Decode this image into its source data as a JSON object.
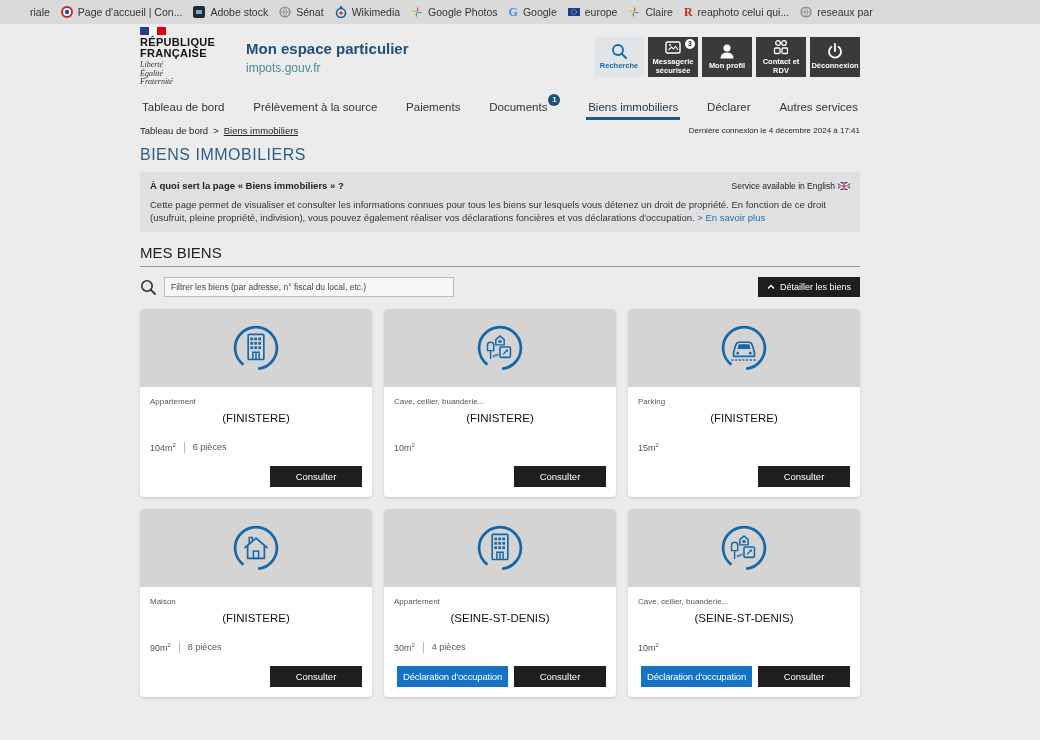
{
  "bookmarks": [
    {
      "label": "riale"
    },
    {
      "kind": "ring",
      "label": "Page d'accueil | Con..."
    },
    {
      "kind": "tile",
      "label": "Adobe stock"
    },
    {
      "kind": "globe",
      "label": "Sénat"
    },
    {
      "kind": "drop",
      "label": "Wikimedia"
    },
    {
      "kind": "pinwheel",
      "label": "Google Photos"
    },
    {
      "kind": "letter",
      "glyph": "G",
      "color": "#4285f4",
      "label": "Google"
    },
    {
      "kind": "flag",
      "label": "europe"
    },
    {
      "kind": "pinwheel",
      "label": "Claire"
    },
    {
      "kind": "letter",
      "glyph": "R",
      "color": "#c62828",
      "label": "reaphoto celui qui..."
    },
    {
      "kind": "globe",
      "label": "reseaux par"
    }
  ],
  "header": {
    "logo": {
      "name": [
        "RÉPUBLIQUE",
        "FRANÇAISE"
      ],
      "motto": [
        "Liberté",
        "Égalité",
        "Fraternité"
      ]
    },
    "title": "Mon espace particulier",
    "site": "impots.gouv.fr",
    "tools": [
      {
        "kind": "search",
        "label": "Recherche"
      },
      {
        "kind": "mail",
        "label": "Messagerie sécurisée",
        "badge": "3"
      },
      {
        "kind": "profile",
        "label": "Mon profil"
      },
      {
        "kind": "contact",
        "label": "Contact et RDV"
      },
      {
        "kind": "logout",
        "label": "Déconnexion"
      }
    ]
  },
  "nav": {
    "tabs": [
      {
        "label": "Tableau de bord",
        "selected": false
      },
      {
        "label": "Prélèvement à la source",
        "selected": false
      },
      {
        "label": "Paiements",
        "selected": false
      },
      {
        "label": "Documents",
        "selected": false,
        "badge": "1"
      },
      {
        "label": "Biens immobiliers",
        "selected": true
      },
      {
        "label": "Déclarer",
        "selected": false
      },
      {
        "label": "Autres services",
        "selected": false
      }
    ]
  },
  "breadcrumb": {
    "items": [
      "Tableau de bord",
      "Biens immobiliers"
    ],
    "separator": ">"
  },
  "last_login": "Dernière connexion le 4 décembre 2024 à 17:41",
  "page_title": "BIENS IMMOBILIERS",
  "help": {
    "question": "À quoi sert la page « Biens immobiliers » ?",
    "language_link": "Service available in English",
    "text": "Cette page permet de visualiser et consulter les informations connues pour tous les biens sur lesquels vous détenez un droit de propriété. En fonction de ce droit (usufruit, pleine propriété, indivision), vous pouvez également réaliser vos déclarations foncières et vos déclarations d'occupation.",
    "more_link": "> En savoir plus"
  },
  "properties": {
    "title": "MES BIENS",
    "filter": {
      "placeholder": "Filtrer les biens (par adresse, n° fiscal du local, etc.)"
    },
    "detail_button": "Détailler les biens",
    "items": [
      {
        "kind": "apartment",
        "type": "Appartement",
        "location": "(FINISTERE)",
        "area": "104m$^{2}$",
        "rooms": "6 pièces",
        "actions": [
          {
            "kind": "consult",
            "label": "Consulter"
          }
        ]
      },
      {
        "kind": "outbuilding",
        "type": "Cave, cellier, buanderie...",
        "location": "(FINISTERE)",
        "area": "10m$^{2}$",
        "actions": [
          {
            "kind": "consult",
            "label": "Consulter"
          }
        ]
      },
      {
        "kind": "parking",
        "type": "Parking",
        "location": "(FINISTERE)",
        "area": "15m$^{2}$",
        "actions": [
          {
            "kind": "consult",
            "label": "Consulter"
          }
        ]
      },
      {
        "kind": "house",
        "type": "Maison",
        "location": "(FINISTERE)",
        "area": "90m$^{2}$",
        "rooms": "8 pièces",
        "actions": [
          {
            "kind": "consult",
            "label": "Consulter"
          }
        ]
      },
      {
        "kind": "apartment",
        "type": "Appartement",
        "location": "(SEINE-ST-DENIS)",
        "area": "30m$^{2}$",
        "rooms": "4 pièces",
        "actions": [
          {
            "kind": "declare",
            "label": "Déclaration d'occupation"
          },
          {
            "kind": "consult",
            "label": "Consulter"
          }
        ]
      },
      {
        "kind": "outbuilding",
        "type": "Cave, cellier, buanderie...",
        "location": "(SEINE-ST-DENIS)",
        "area": "10m$^{2}$",
        "actions": [
          {
            "kind": "declare",
            "label": "Déclaration d'occupation"
          },
          {
            "kind": "consult",
            "label": "Consulter"
          }
        ]
      }
    ]
  }
}
